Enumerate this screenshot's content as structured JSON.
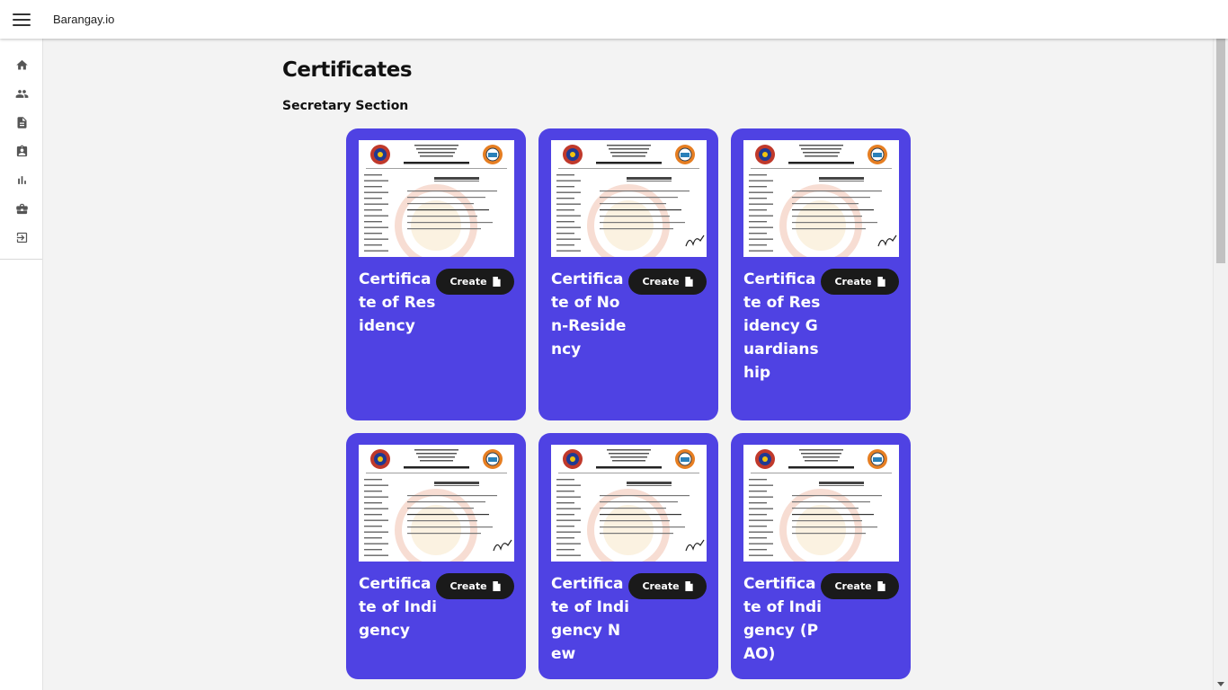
{
  "app": {
    "brand": "Barangay.io"
  },
  "sidebar": {
    "items": [
      {
        "name": "home",
        "icon": "home-icon"
      },
      {
        "name": "residents",
        "icon": "people-icon"
      },
      {
        "name": "certificates",
        "icon": "document-icon"
      },
      {
        "name": "blotter",
        "icon": "clipboard-user-icon"
      },
      {
        "name": "reports",
        "icon": "bar-chart-icon"
      },
      {
        "name": "business",
        "icon": "briefcase-icon"
      },
      {
        "name": "logout",
        "icon": "logout-icon"
      }
    ]
  },
  "page": {
    "title": "Certificates",
    "section": "Secretary Section"
  },
  "cards": [
    {
      "title": "Certificate of Residency",
      "button": "Create"
    },
    {
      "title": "Certificate of Non-Residency",
      "button": "Create"
    },
    {
      "title": "Certificate of Residency Guardianship",
      "button": "Create"
    },
    {
      "title": "Certificate of Indigency",
      "button": "Create"
    },
    {
      "title": "Certificate of Indigency New",
      "button": "Create"
    },
    {
      "title": "Certificate of Indigency (PAO)",
      "button": "Create"
    }
  ],
  "colors": {
    "card": "#4f42e3",
    "button": "#1a1a1a",
    "background": "#f3f3f3"
  }
}
